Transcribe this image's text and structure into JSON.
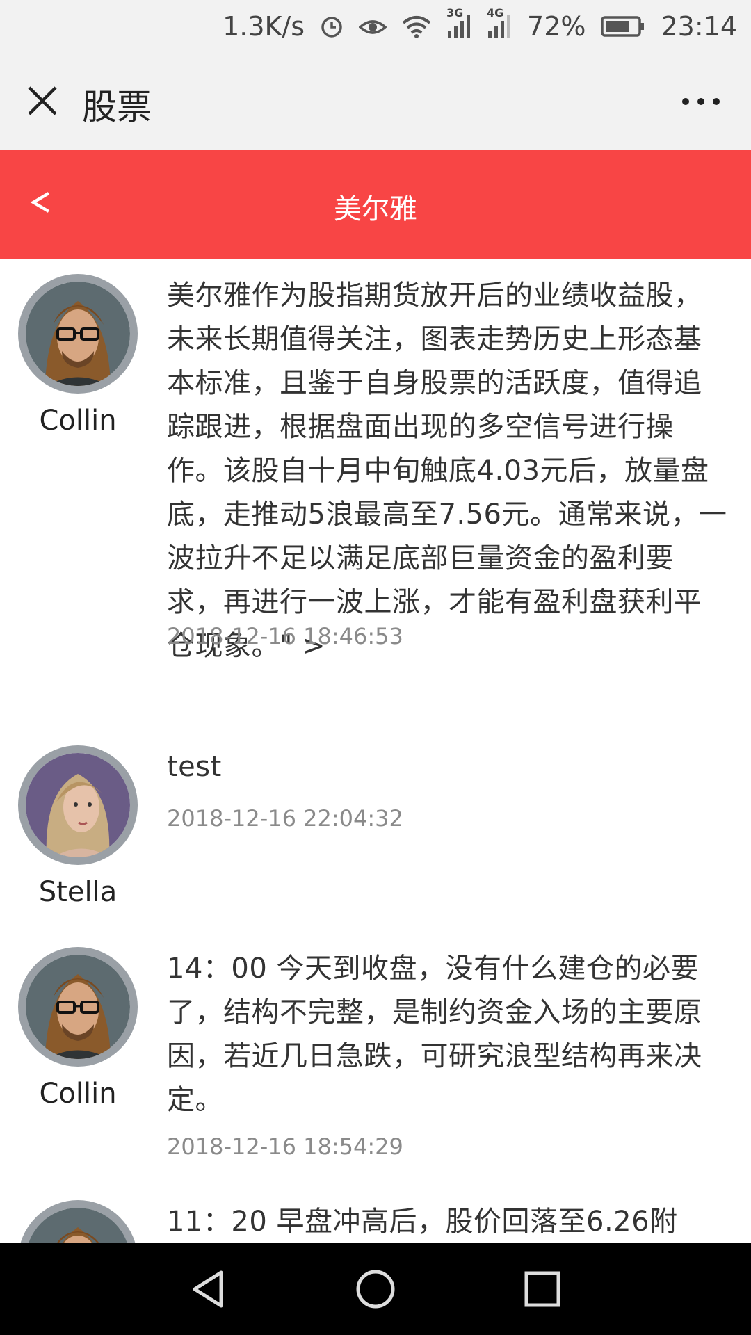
{
  "status_bar": {
    "speed": "1.3K/s",
    "net1": "3G",
    "net2": "4G",
    "battery": "72%",
    "time": "23:14"
  },
  "titlebar": {
    "title": "股票"
  },
  "header": {
    "title": "美尔雅"
  },
  "posts": [
    {
      "author": "Collin",
      "content": "美尔雅作为股指期货放开后的业绩收益股，未来长期值得关注，图表走势历史上形态基本标准，且鉴于自身股票的活跃度，值得追踪跟进，根据盘面出现的多空信号进行操作。该股自十月中旬触底4.03元后，放量盘底，走推动5浪最高至7.56元。通常来说，一波拉升不足以满足底部巨量资金的盈利要求，再进行一波上涨，才能有盈利盘获利平仓现象。\" >",
      "time": "2018-12-16 18:46:53"
    },
    {
      "author": "Stella",
      "content": "test",
      "time": "2018-12-16 22:04:32"
    },
    {
      "author": "Collin",
      "content": "14：00 今天到收盘，没有什么建仓的必要了，结构不完整，是制约资金入场的主要原因，若近几日急跌，可研究浪型结构再来决定。",
      "time": "2018-12-16 18:54:29"
    },
    {
      "author": "",
      "content": "11：20 早盘冲高后，股价回落至6.26附",
      "time": ""
    }
  ],
  "colors": {
    "header_red": "#f84545",
    "bar_gray": "#f2f2f2",
    "nav_black": "#000000"
  }
}
